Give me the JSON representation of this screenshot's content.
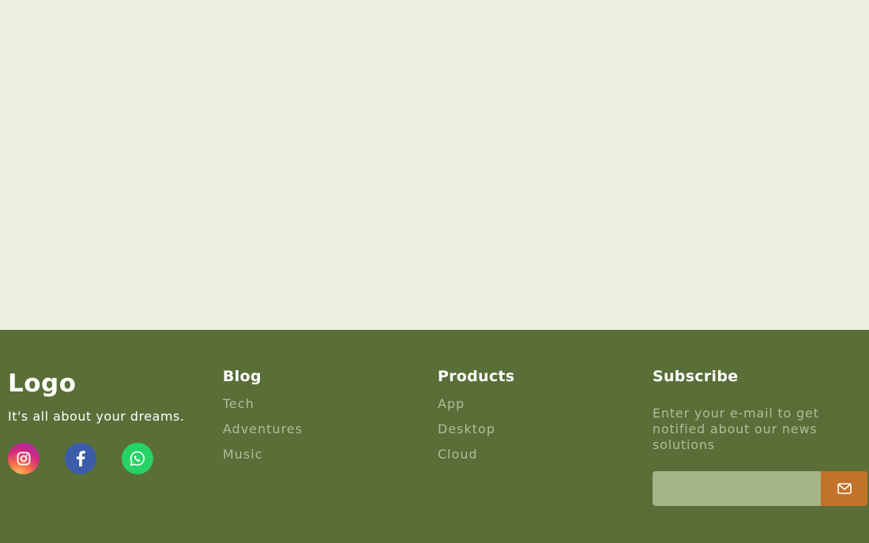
{
  "brand": {
    "logo": "Logo",
    "tagline": "It's all about your dreams.",
    "socials": [
      {
        "icon": "instagram-icon",
        "color": "#d3277e"
      },
      {
        "icon": "facebook-icon",
        "color": "#3b5ca8"
      },
      {
        "icon": "whatsapp-icon",
        "color": "#25d366"
      }
    ]
  },
  "blog": {
    "title": "Blog",
    "links": [
      "Tech",
      "Adventures",
      "Music"
    ]
  },
  "products": {
    "title": "Products",
    "links": [
      "App",
      "Desktop",
      "Cloud"
    ]
  },
  "subscribe": {
    "title": "Subscribe",
    "description": "Enter your e-mail to get notified about our news solutions",
    "email_value": "",
    "button_icon": "envelope-icon"
  },
  "colors": {
    "page_background": "#edf0e0",
    "footer_background": "#5a6e38",
    "link_text": "#b3bb9a",
    "input_background": "#a5b486",
    "subscribe_button": "#c2722a"
  }
}
